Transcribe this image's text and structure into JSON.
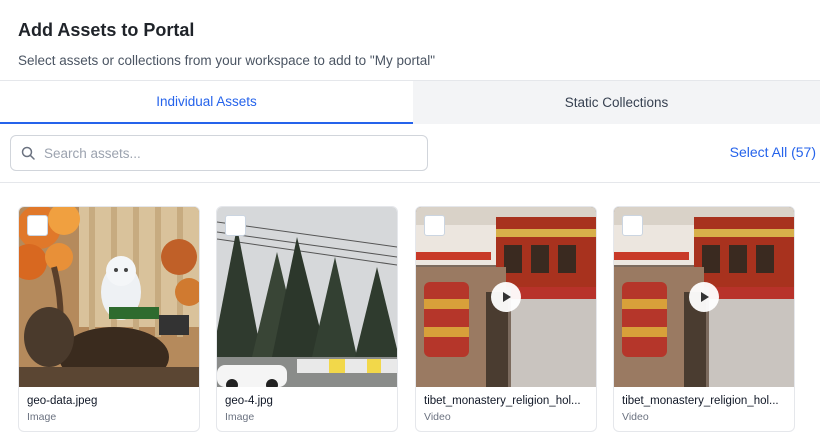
{
  "header": {
    "title": "Add Assets to Portal",
    "subtitle": "Select assets or collections from your workspace to add to \"My portal\""
  },
  "tabs": [
    {
      "label": "Individual Assets",
      "active": true
    },
    {
      "label": "Static Collections",
      "active": false
    }
  ],
  "search": {
    "placeholder": "Search assets...",
    "value": ""
  },
  "select_all": "Select All (57)",
  "assets": [
    {
      "name": "geo-data.jpeg",
      "type": "Image"
    },
    {
      "name": "geo-4.jpg",
      "type": "Image"
    },
    {
      "name": "tibet_monastery_religion_hol...",
      "type": "Video"
    },
    {
      "name": "tibet_monastery_religion_hol...",
      "type": "Video"
    }
  ],
  "colors": {
    "accent": "#2563eb",
    "border": "#e5e7eb",
    "inactive_tab_bg": "#f3f4f6"
  },
  "icons": [
    "search-icon",
    "play-icon",
    "checkbox"
  ]
}
